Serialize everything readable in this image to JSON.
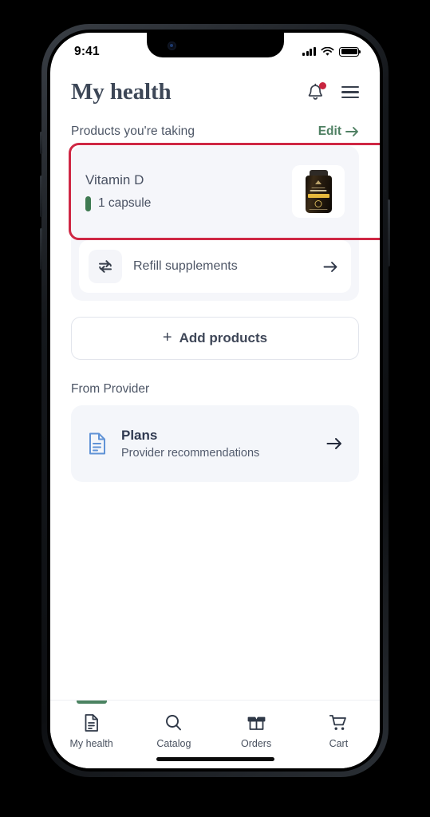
{
  "status_bar": {
    "time": "9:41",
    "signal_icon": "cellular-signal-icon",
    "wifi_icon": "wifi-icon",
    "battery_icon": "battery-icon"
  },
  "header": {
    "title": "My health",
    "notifications_icon": "bell-icon",
    "has_notification_badge": true,
    "menu_icon": "hamburger-menu-icon"
  },
  "products_section": {
    "title": "Products you're taking",
    "edit_label": "Edit",
    "edit_arrow": "→",
    "highlighted": true,
    "highlight_color": "#cf2744",
    "items": [
      {
        "name": "Vitamin D",
        "dose": "1 capsule",
        "dose_marker_color": "#3f7a52",
        "thumbnail": "supplement-bottle-image"
      }
    ],
    "refill": {
      "label": "Refill supplements",
      "icon": "refresh-repeat-icon",
      "arrow": "→"
    },
    "add_products": {
      "label": "Add products",
      "plus": "+"
    }
  },
  "provider_section": {
    "title": "From Provider",
    "cards": [
      {
        "title": "Plans",
        "subtitle": "Provider recommendations",
        "icon": "document-icon",
        "icon_color": "#6093d6",
        "arrow": "→"
      }
    ]
  },
  "tab_bar": {
    "active_index": 0,
    "active_color": "#4b8361",
    "tabs": [
      {
        "label": "My health",
        "icon": "document-icon"
      },
      {
        "label": "Catalog",
        "icon": "search-icon"
      },
      {
        "label": "Orders",
        "icon": "package-box-icon"
      },
      {
        "label": "Cart",
        "icon": "shopping-cart-icon"
      }
    ]
  },
  "theme": {
    "accent_green": "#4f8063",
    "highlight_red": "#cf2744",
    "panel_bg": "#f5f6fa",
    "text_dark": "#3d4757"
  }
}
